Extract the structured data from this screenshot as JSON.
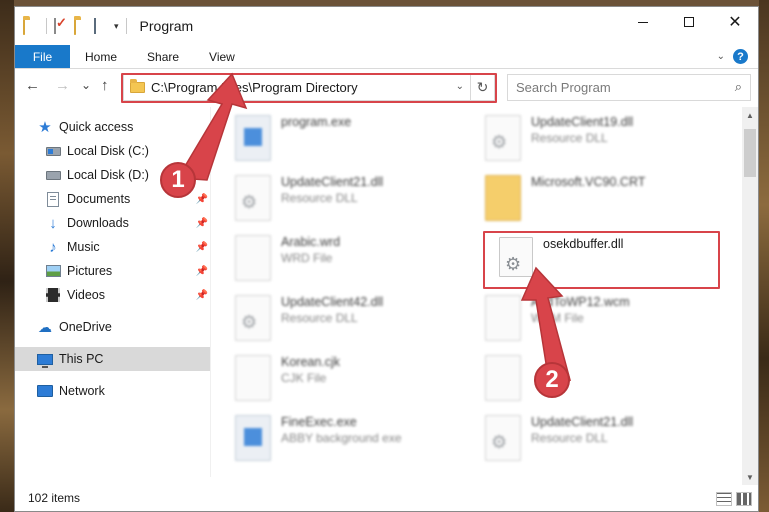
{
  "titlebar": {
    "title": "Program"
  },
  "ribbon": {
    "tabs": [
      {
        "label": "File"
      },
      {
        "label": "Home"
      },
      {
        "label": "Share"
      },
      {
        "label": "View"
      }
    ],
    "help": "?"
  },
  "nav": {
    "back": "←",
    "forward": "→",
    "recent": "⌄",
    "up": "↑",
    "address": "C:\\Program Files\\Program Directory",
    "refresh": "↻",
    "search_placeholder": "Search Program",
    "search_icon": "⌕"
  },
  "sidebar": {
    "items": [
      {
        "label": "Quick access",
        "icon": "star-icon"
      },
      {
        "label": "Local Disk (C:)",
        "icon": "drive-icon"
      },
      {
        "label": "Local Disk (D:)",
        "icon": "drive-icon"
      },
      {
        "label": "Documents",
        "icon": "documents-icon"
      },
      {
        "label": "Downloads",
        "icon": "download-icon"
      },
      {
        "label": "Music",
        "icon": "music-icon"
      },
      {
        "label": "Pictures",
        "icon": "pictures-icon"
      },
      {
        "label": "Videos",
        "icon": "videos-icon"
      },
      {
        "label": "OneDrive",
        "icon": "cloud-icon"
      },
      {
        "label": "This PC",
        "icon": "computer-icon"
      },
      {
        "label": "Network",
        "icon": "network-icon"
      }
    ]
  },
  "files": [
    {
      "name": "program.exe",
      "type": ""
    },
    {
      "name": "UpdateClient19.dll",
      "type": "Resource DLL"
    },
    {
      "name": "UpdateClient21.dll",
      "type": "Resource DLL"
    },
    {
      "name": "Microsoft.VC90.CRT",
      "type": ""
    },
    {
      "name": "Arabic.wrd",
      "type": "WRD File"
    },
    {
      "name": "osekdbuffer.dll",
      "type": ""
    },
    {
      "name": "UpdateClient42.dll",
      "type": "Resource DLL"
    },
    {
      "name": "AddToWP12.wcm",
      "type": "WCM File"
    },
    {
      "name": "Korean.cjk",
      "type": "CJK File"
    },
    {
      "name": "",
      "type": ""
    },
    {
      "name": "FineExec.exe",
      "type": "ABBY background exe"
    },
    {
      "name": "UpdateClient21.dll",
      "type": "Resource DLL"
    }
  ],
  "status": {
    "count": "102 items"
  },
  "callouts": {
    "one": "1",
    "two": "2"
  },
  "colors": {
    "accent": "#1979ca",
    "highlight": "#d8444a"
  }
}
